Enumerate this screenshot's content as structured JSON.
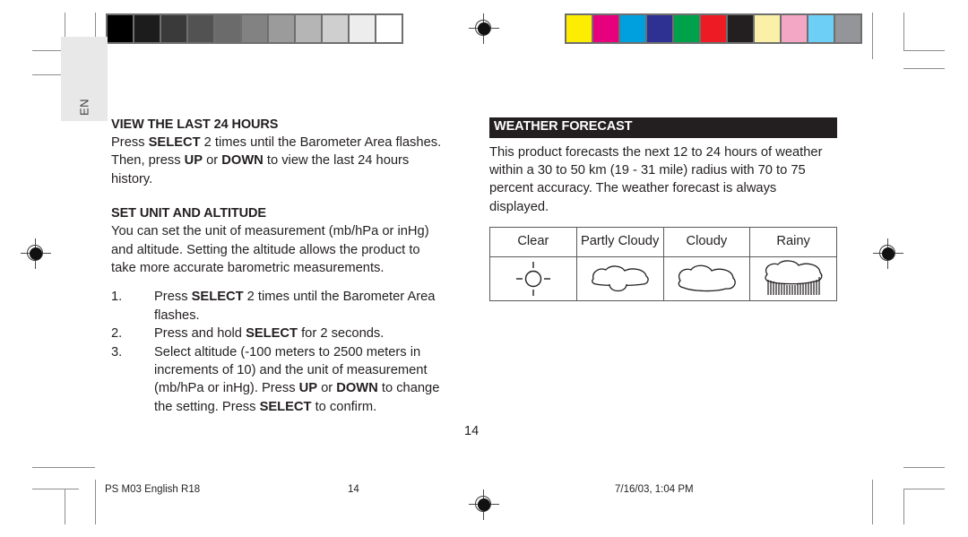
{
  "page": {
    "language_tab": "EN",
    "folio": "14"
  },
  "calibration": {
    "grayscale_label": "grayscale-calibration-strip",
    "grayscale_swatches": [
      "#000000",
      "#1c1c1c",
      "#3a3a3a",
      "#525252",
      "#6b6b6b",
      "#828282",
      "#9b9b9b",
      "#b5b5b5",
      "#cfcfcf",
      "#ededed",
      "#ffffff"
    ],
    "color_label": "color-calibration-strip",
    "color_swatches": [
      "#fded00",
      "#e6007e",
      "#00a0df",
      "#2e3192",
      "#00a14b",
      "#ed1c24",
      "#231f20",
      "#fbf0a8",
      "#f4a7c4",
      "#6dcff6",
      "#939598"
    ]
  },
  "left_column": {
    "section1": {
      "heading": "VIEW THE LAST 24 HOURS",
      "paragraph": {
        "part1": "Press ",
        "bold1": "SELECT",
        "part2": " 2 times until the Barometer Area flashes. Then, press ",
        "bold2": "UP",
        "part3": " or ",
        "bold3": "DOWN",
        "part4": " to view the last 24 hours history."
      }
    },
    "section2": {
      "heading": "SET UNIT AND ALTITUDE",
      "paragraph": "You can set the unit of measurement (mb/hPa or inHg) and altitude. Setting the altitude allows the product to take more accurate barometric measurements.",
      "steps": [
        {
          "number": "1.",
          "part1": "Press ",
          "bold1": "SELECT",
          "part2": " 2 times until the Barometer Area flashes."
        },
        {
          "number": "2.",
          "part1": "Press and hold ",
          "bold1": "SELECT",
          "part2": " for 2 seconds."
        },
        {
          "number": "3.",
          "part1": "Select altitude (-100 meters to 2500 meters in increments of 10) and the unit of measurement (mb/hPa or inHg). Press ",
          "bold1": "UP",
          "part2": " or ",
          "bold2": "DOWN",
          "part3": " to change the setting. Press ",
          "bold3": "SELECT",
          "part4": " to confirm."
        }
      ]
    }
  },
  "right_column": {
    "section": {
      "heading": "WEATHER FORECAST",
      "paragraph": "This product forecasts the next 12 to 24 hours of weather within a 30 to 50 km (19 - 31 mile) radius with 70 to 75 percent accuracy. The weather forecast is always displayed."
    },
    "weather_table": {
      "headers": [
        "Clear",
        "Partly Cloudy",
        "Cloudy",
        "Rainy"
      ],
      "icons": [
        "sun-icon",
        "partly-cloudy-icon",
        "cloudy-icon",
        "rainy-icon"
      ]
    }
  },
  "footer": {
    "job_name": "PS M03 English R18",
    "page_number": "14",
    "timestamp": "7/16/03, 1:04 PM"
  }
}
